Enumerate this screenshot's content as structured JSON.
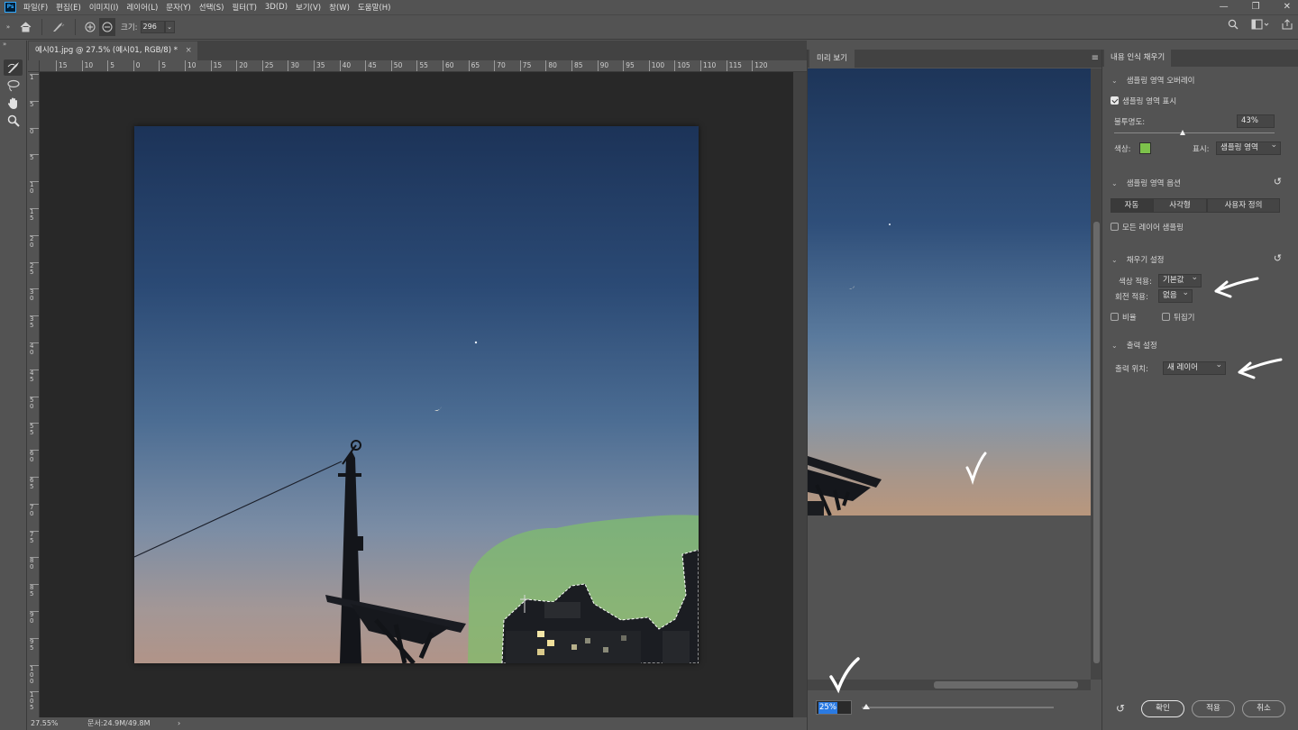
{
  "app": {
    "logo": "Ps"
  },
  "menu": [
    "파일(F)",
    "편집(E)",
    "이미지(I)",
    "레이어(L)",
    "문자(Y)",
    "선택(S)",
    "필터(T)",
    "3D(D)",
    "보기(V)",
    "창(W)",
    "도움말(H)"
  ],
  "options": {
    "size_label": "크기:",
    "size_value": "296"
  },
  "document": {
    "tab_title": "예시01.jpg @ 27.5% (예시01, RGB/8) *",
    "ruler_h": [
      "15",
      "10",
      "5",
      "0",
      "5",
      "10",
      "15",
      "20",
      "25",
      "30",
      "35",
      "40",
      "45",
      "50",
      "55",
      "60",
      "65",
      "70",
      "75",
      "80",
      "85",
      "90",
      "95",
      "100",
      "105",
      "110",
      "115",
      "120"
    ],
    "ruler_v": [
      "1",
      "5",
      "0",
      "5",
      "1\n0",
      "1\n5",
      "2\n0",
      "2\n5",
      "3\n0",
      "3\n5",
      "4\n0",
      "4\n5",
      "5\n0",
      "5\n5",
      "6\n0",
      "6\n5",
      "7\n0",
      "7\n5",
      "8\n0",
      "8\n5",
      "9\n0",
      "9\n5",
      "1\n0\n0",
      "1\n0\n5"
    ],
    "zoom": "27.55%",
    "doc_info": "문서:24.9M/49.8M"
  },
  "preview": {
    "tab": "미리 보기",
    "zoom": "25%",
    "zoom_level": 0.01
  },
  "panel": {
    "tab": "내용 인식 채우기",
    "sampling_overlay": {
      "header": "샘플링 영역 오버레이",
      "show_label": "샘플링 영역 표시",
      "show_checked": true,
      "opacity_label": "불투명도:",
      "opacity_value": "43%",
      "opacity_level": 0.43,
      "color_label": "색상:",
      "color": "#7dc24b",
      "display_label": "표시:",
      "display_value": "샘플링 영역"
    },
    "sampling_options": {
      "header": "샘플링 영역 옵션",
      "modes": [
        "자동",
        "사각형",
        "사용자 정의"
      ],
      "all_layers_label": "모든 레이어 샘플링"
    },
    "fill_settings": {
      "header": "채우기 설정",
      "color_adapt_label": "색상 적용:",
      "color_adapt_value": "기본값",
      "rotation_label": "회전 적용:",
      "rotation_value": "없음",
      "scale_label": "비율",
      "mirror_label": "뒤집기"
    },
    "output": {
      "header": "출력 설정",
      "output_label": "출력 위치:",
      "output_value": "새 레이어"
    },
    "buttons": {
      "ok": "확인",
      "apply": "적용",
      "cancel": "취소"
    }
  }
}
